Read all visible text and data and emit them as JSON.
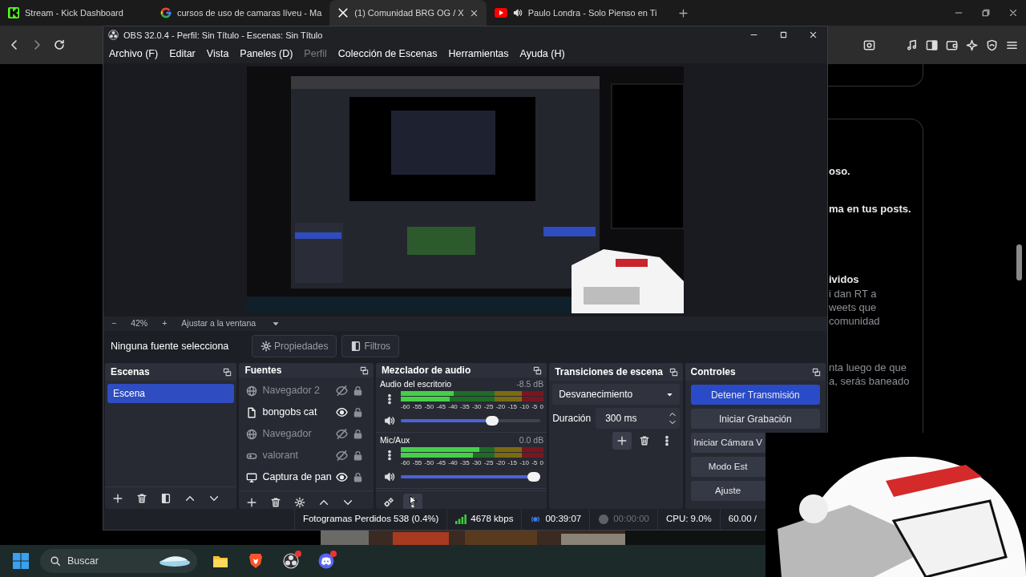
{
  "browser": {
    "tabs": [
      {
        "title": "Stream - Kick Dashboard",
        "kind": "kick",
        "selected": false,
        "audio": false
      },
      {
        "title": "cursos de uso de camaras líveu - Ma",
        "kind": "google",
        "selected": false,
        "audio": false
      },
      {
        "title": "(1) Comunidad BRG OG / X",
        "kind": "x",
        "selected": true,
        "audio": false
      },
      {
        "title": "Paulo Londra - Solo Pienso en Ti",
        "kind": "youtube",
        "selected": false,
        "audio": true
      }
    ]
  },
  "page": {
    "blocks": [
      {
        "title": "oso."
      },
      {
        "title": "ma en tus posts."
      },
      {
        "title": "ividos",
        "lines": [
          "i dan RT a",
          "weets que",
          "comunidad"
        ]
      },
      {
        "lines": [
          "nta luego de que",
          "a, serás baneado"
        ]
      }
    ]
  },
  "obs": {
    "title": "OBS 32.0.4 - Perfil: Sin Título - Escenas: Sin Título",
    "menu": [
      {
        "label": "Archivo (F)",
        "disabled": false
      },
      {
        "label": "Editar",
        "disabled": false
      },
      {
        "label": "Vista",
        "disabled": false
      },
      {
        "label": "Paneles (D)",
        "disabled": false
      },
      {
        "label": "Perfil",
        "disabled": true
      },
      {
        "label": "Colección de Escenas",
        "disabled": false
      },
      {
        "label": "Herramientas",
        "disabled": false
      },
      {
        "label": "Ayuda (H)",
        "disabled": false
      }
    ],
    "zoom": {
      "minus": "−",
      "value": "42%",
      "plus": "+",
      "fit": "Ajustar a la ventana"
    },
    "source_bar": {
      "status": "Ninguna fuente selecciona",
      "buttons": [
        {
          "label": "Propiedades",
          "kind": "gear"
        },
        {
          "label": "Filtros",
          "kind": "filter"
        }
      ]
    },
    "scenes": {
      "title": "Escenas",
      "items": [
        {
          "label": "Escena",
          "selected": true
        }
      ]
    },
    "sources": {
      "title": "Fuentes",
      "items": [
        {
          "label": "Navegador 2",
          "kind": "browser",
          "visible": false,
          "locked": false
        },
        {
          "label": "bongobs cat",
          "visible": true,
          "locked": false
        },
        {
          "label": "Navegador",
          "kind": "browser",
          "visible": false,
          "locked": false
        },
        {
          "label": "valorant",
          "kind": "game",
          "visible": false,
          "locked": false
        },
        {
          "label": "Captura de pan",
          "kind": "display",
          "visible": true,
          "locked": false
        }
      ]
    },
    "mixer": {
      "title": "Mezclador de audio",
      "channels": [
        {
          "name": "Audio del escritorio",
          "reading": "-8.5 dB",
          "meter": {
            "level": 0.37
          },
          "volume": {
            "level": 0.67
          },
          "scale": [
            "-60",
            "-55",
            "-50",
            "-45",
            "-40",
            "-35",
            "-30",
            "-25",
            "-20",
            "-15",
            "-10",
            "-5",
            "0"
          ]
        },
        {
          "name": "Mic/Aux",
          "reading": "0.0 dB",
          "meter": {
            "level": 0.55
          },
          "volume": {
            "level": 1.0
          },
          "scale": [
            "-60",
            "-55",
            "-50",
            "-45",
            "-40",
            "-35",
            "-30",
            "-25",
            "-20",
            "-15",
            "-10",
            "-5",
            "0"
          ]
        }
      ]
    },
    "transitions": {
      "title": "Transiciones de escena",
      "selected": "Desvanecimiento",
      "duration_label": "Duración",
      "duration": "300 ms"
    },
    "controls": {
      "title": "Controles",
      "buttons": [
        {
          "label": "Detener Transmisión",
          "active": true
        },
        {
          "label": "Iniciar Grabación",
          "active": false
        },
        {
          "label": "Iniciar Cámara V",
          "active": false
        },
        {
          "label": "Modo Est",
          "active": false
        },
        {
          "label": "Ajuste",
          "active": false
        }
      ]
    },
    "status": [
      {
        "kind": "text",
        "text": "Fotogramas Perdidos 538 (0.4%)"
      },
      {
        "kind": "signal",
        "text": "4678 kbps"
      },
      {
        "kind": "stream",
        "text": "00:39:07",
        "active": true
      },
      {
        "kind": "record",
        "text": "00:00:00",
        "active": false
      },
      {
        "kind": "text",
        "text": "CPU: 9.0%"
      },
      {
        "kind": "text",
        "text": "60.00 /"
      }
    ]
  },
  "taskbar": {
    "search": {
      "placeholder": "Buscar"
    },
    "apps": [
      {
        "kind": "explorer",
        "badge": false
      },
      {
        "kind": "brave",
        "badge": false
      },
      {
        "kind": "obs",
        "badge": true
      },
      {
        "kind": "discord",
        "badge": true
      }
    ]
  }
}
